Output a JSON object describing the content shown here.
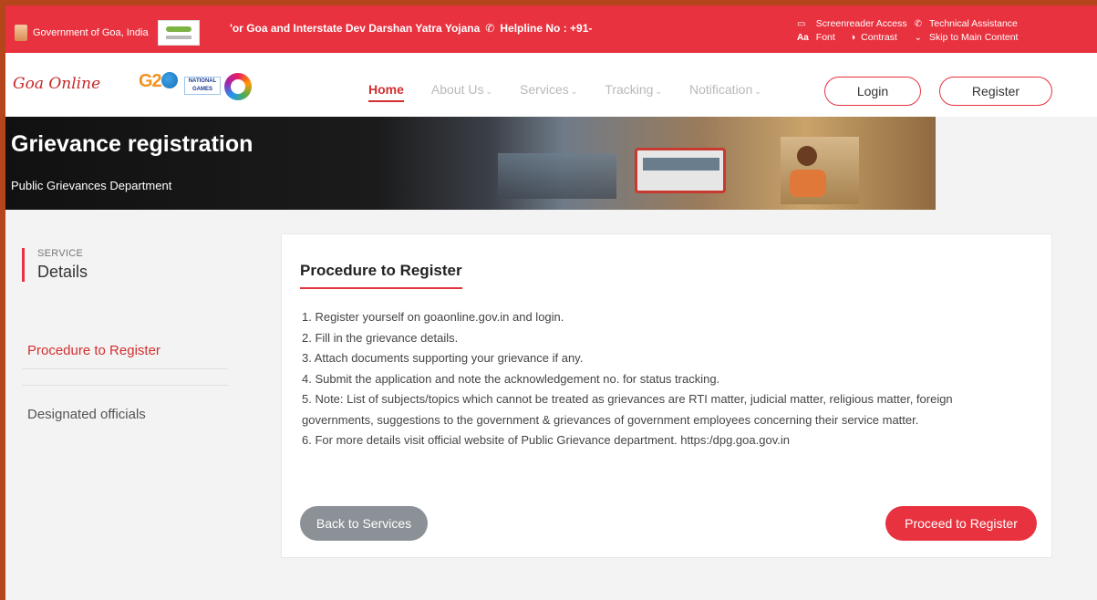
{
  "topbar": {
    "gov_label": "Government of Goa, India",
    "marquee": "'or Goa and Interstate Dev Darshan Yatra Yojana",
    "helpline": "Helpline No : +91-",
    "screenreader": "Screenreader Access",
    "technical": "Technical Assistance",
    "font": "Font",
    "contrast": "Contrast",
    "skip": "Skip to Main Content",
    "font_symbol": "Aa"
  },
  "nav": {
    "logo": "Goa Online",
    "g20": "G2",
    "games_label": "NATIONAL GAMES",
    "items": [
      {
        "label": "Home",
        "active": true
      },
      {
        "label": "About Us",
        "chev": "⌄"
      },
      {
        "label": "Services",
        "chev": "⌄"
      },
      {
        "label": "Tracking",
        "chev": "⌄"
      },
      {
        "label": "Notification",
        "chev": "⌄"
      }
    ],
    "login": "Login",
    "register": "Register"
  },
  "banner": {
    "title": "Grievance registration",
    "department": "Public Grievances Department"
  },
  "sidebar": {
    "small": "SERVICE",
    "big": "Details",
    "links": [
      "Procedure to Register",
      "Designated officials"
    ]
  },
  "card": {
    "title": "Procedure to Register",
    "steps": [
      "1. Register yourself on goaonline.gov.in and login.",
      "2. Fill in the grievance details.",
      "3. Attach documents supporting your grievance if any.",
      "4. Submit the application and note the acknowledgement no. for status tracking.",
      "5. Note: List of subjects/topics which cannot be treated as grievances are RTI matter, judicial matter, religious matter, foreign governments, suggestions to the government & grievances of government employees concerning their service matter.",
      "6. For more details visit official website of Public Grievance department. https:/dpg.goa.gov.in"
    ],
    "back": "Back to Services",
    "proceed": "Proceed to Register"
  },
  "colors": {
    "accent": "#e8323f",
    "text": "#444444",
    "back_button": "#8b9196"
  }
}
